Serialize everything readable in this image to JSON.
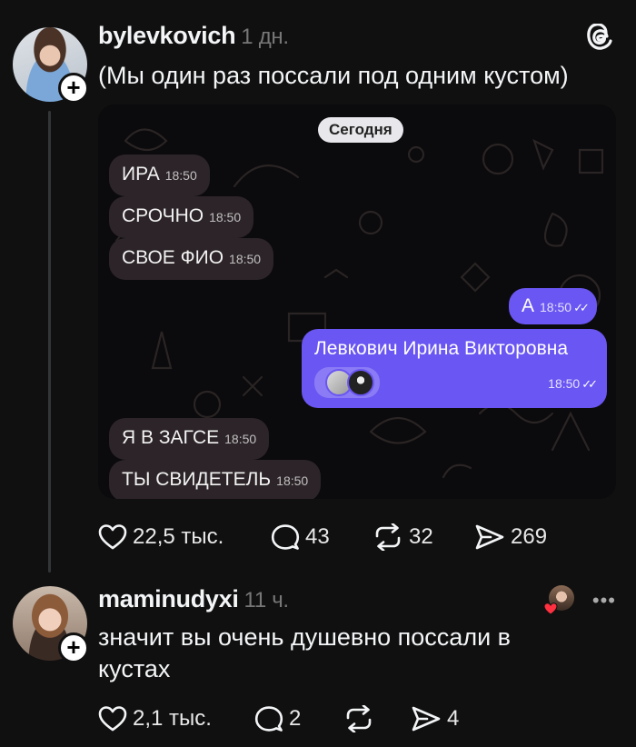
{
  "post": {
    "username": "bylevkovich",
    "time": "1 дн.",
    "text": "(Мы один раз поссали под одним кустом)",
    "chat": {
      "date": "Сегодня",
      "messages": [
        {
          "text": "ИРА",
          "time": "18:50"
        },
        {
          "text": "СРОЧНО",
          "time": "18:50"
        },
        {
          "text": "СВОЕ ФИО",
          "time": "18:50"
        },
        {
          "text": "А",
          "time": "18:50"
        },
        {
          "text": "Левкович Ирина Викторовна",
          "time": "18:50"
        },
        {
          "text": "Я В ЗАГСЕ",
          "time": "18:50"
        },
        {
          "text": "ТЫ СВИДЕТЕЛЬ",
          "time": "18:50"
        }
      ]
    },
    "actions": {
      "likes": "22,5 тыс.",
      "comments": "43",
      "reposts": "32",
      "shares": "269"
    }
  },
  "reply": {
    "username": "maminudyxi",
    "time": "11 ч.",
    "text": "значит вы очень душевно поссали в кустах",
    "actions": {
      "likes": "2,1 тыс.",
      "comments": "2",
      "shares": "4"
    }
  },
  "colors": {
    "background": "#101010",
    "outgoing_bubble": "#6a56f2",
    "incoming_bubble": "#2c2428",
    "like_heart": "#ff3040"
  },
  "icons": [
    "threads-logo-icon",
    "heart-icon",
    "comment-icon",
    "repost-icon",
    "share-icon",
    "more-icon",
    "plus-icon"
  ]
}
